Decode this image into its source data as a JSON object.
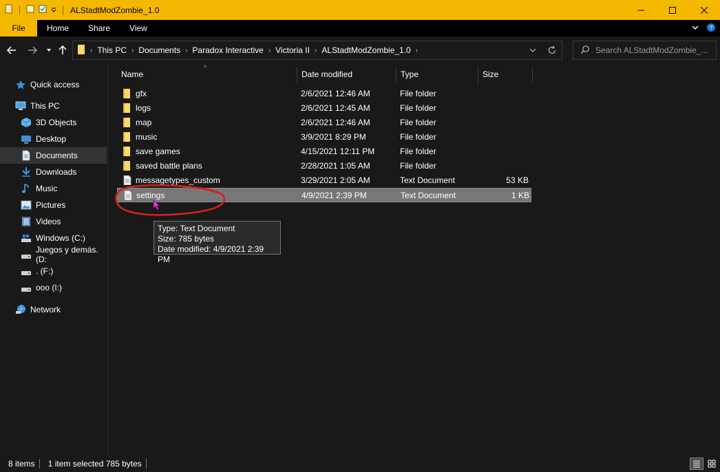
{
  "window": {
    "title": "ALStadtModZombie_1.0",
    "accent": "#f5b800"
  },
  "ribbon": {
    "tabs": [
      "File",
      "Home",
      "Share",
      "View"
    ]
  },
  "address": {
    "crumbs": [
      "This PC",
      "Documents",
      "Paradox Interactive",
      "Victoria II",
      "ALStadtModZombie_1.0"
    ]
  },
  "search": {
    "placeholder": "Search ALStadtModZombie_..."
  },
  "nav": {
    "items": [
      {
        "label": "Quick access",
        "icon": "star-icon"
      },
      {
        "label": "This PC",
        "icon": "computer-icon"
      },
      {
        "label": "3D Objects",
        "icon": "cube-icon"
      },
      {
        "label": "Desktop",
        "icon": "desktop-icon"
      },
      {
        "label": "Documents",
        "icon": "document-icon"
      },
      {
        "label": "Downloads",
        "icon": "download-icon"
      },
      {
        "label": "Music",
        "icon": "music-icon"
      },
      {
        "label": "Pictures",
        "icon": "picture-icon"
      },
      {
        "label": "Videos",
        "icon": "video-icon"
      },
      {
        "label": "Windows (C:)",
        "icon": "windows-drive-icon"
      },
      {
        "label": "Juegos y demás. (D:",
        "icon": "drive-icon"
      },
      {
        "label": ". (F:)",
        "icon": "drive-icon"
      },
      {
        "label": "ooo (I:)",
        "icon": "drive-icon"
      },
      {
        "label": "Network",
        "icon": "network-icon"
      }
    ]
  },
  "columns": {
    "name": "Name",
    "date": "Date modified",
    "type": "Type",
    "size": "Size"
  },
  "files": [
    {
      "name": "gfx",
      "date": "2/6/2021 12:46 AM",
      "type": "File folder",
      "size": "",
      "icon": "folder-icon"
    },
    {
      "name": "logs",
      "date": "2/6/2021 12:45 AM",
      "type": "File folder",
      "size": "",
      "icon": "folder-icon"
    },
    {
      "name": "map",
      "date": "2/6/2021 12:46 AM",
      "type": "File folder",
      "size": "",
      "icon": "folder-icon"
    },
    {
      "name": "music",
      "date": "3/9/2021 8:29 PM",
      "type": "File folder",
      "size": "",
      "icon": "folder-icon"
    },
    {
      "name": "save games",
      "date": "4/15/2021 12:11 PM",
      "type": "File folder",
      "size": "",
      "icon": "folder-icon"
    },
    {
      "name": "saved battle plans",
      "date": "2/28/2021 1:05 AM",
      "type": "File folder",
      "size": "",
      "icon": "folder-icon"
    },
    {
      "name": "messagetypes_custom",
      "date": "3/29/2021 2:05 AM",
      "type": "Text Document",
      "size": "53 KB",
      "icon": "text-file-icon"
    },
    {
      "name": "settings",
      "date": "4/9/2021 2:39 PM",
      "type": "Text Document",
      "size": "1 KB",
      "icon": "text-file-icon"
    }
  ],
  "tooltip": {
    "line1": "Type: Text Document",
    "line2": "Size: 785 bytes",
    "line3": "Date modified: 4/9/2021 2:39 PM"
  },
  "status": {
    "count": "8 items",
    "selected": "1 item selected  785 bytes"
  }
}
